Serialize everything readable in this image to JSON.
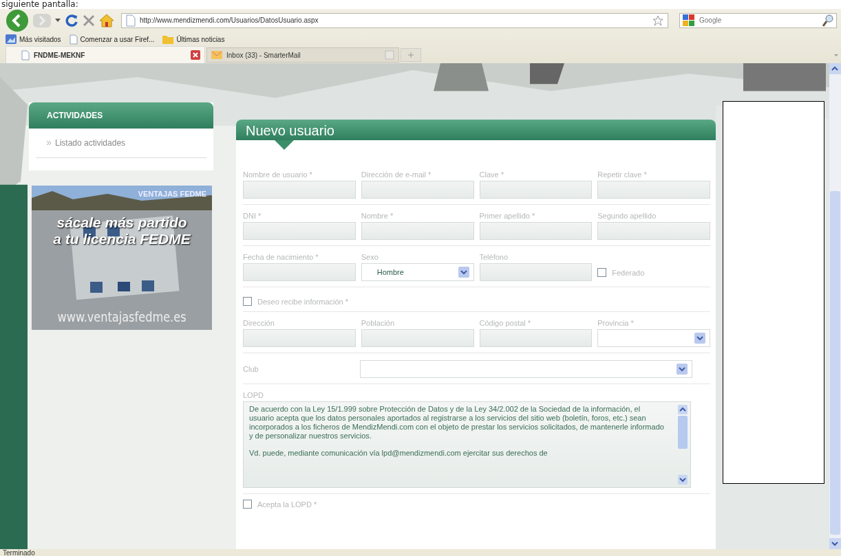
{
  "caption": "siguiente pantalla:",
  "toolbar": {
    "url": "http://www.mendizmendi.com/Usuarios/DatosUsuario.aspx",
    "search_placeholder": "Google"
  },
  "bookmarks": [
    {
      "label": "Más visitados",
      "kind": "feed"
    },
    {
      "label": "Comenzar a usar Firef...",
      "kind": "page"
    },
    {
      "label": "Últimas noticias",
      "kind": "folder"
    }
  ],
  "tabs": [
    {
      "label": "FNDME-MEKNF",
      "selected": true,
      "kind": "page"
    },
    {
      "label": "Inbox (33) - SmarterMail",
      "selected": false,
      "kind": "mail"
    }
  ],
  "sidebar": {
    "title": "ACTIVIDADES",
    "items": [
      "Listado actividades"
    ]
  },
  "banner": {
    "header": "VENTAJAS FEDME",
    "headline": [
      "sácale más partido",
      "a tu licencia FEDME"
    ],
    "url": "www.ventajasfedme.es"
  },
  "form": {
    "title": "Nuevo usuario",
    "rows": [
      [
        {
          "kind": "text",
          "label": "Nombre de usuario *"
        },
        {
          "kind": "text",
          "label": "Dirección de e-mail *"
        },
        {
          "kind": "text",
          "label": "Clave *"
        },
        {
          "kind": "text",
          "label": "Repetir clave *"
        }
      ],
      [
        {
          "kind": "text",
          "label": "DNI *"
        },
        {
          "kind": "text",
          "label": "Nombre *"
        },
        {
          "kind": "text",
          "label": "Primer apellido *"
        },
        {
          "kind": "text",
          "label": "Segundo apellido"
        }
      ],
      [
        {
          "kind": "text",
          "label": "Fecha de nacimiento *"
        },
        {
          "kind": "select",
          "label": "Sexo",
          "value": "Hombre"
        },
        {
          "kind": "text",
          "label": "Teléfono"
        },
        {
          "kind": "checkbox",
          "label": "Federado",
          "checked": false
        }
      ],
      [
        {
          "kind": "checkbox",
          "label": "Deseo recibe información *",
          "checked": false
        }
      ],
      [
        {
          "kind": "text",
          "label": "Dirección"
        },
        {
          "kind": "text",
          "label": "Población"
        },
        {
          "kind": "text",
          "label": "Código postal *"
        },
        {
          "kind": "select",
          "label": "Provincia *"
        }
      ],
      [
        {
          "kind": "wide-select",
          "label": "Club"
        }
      ]
    ],
    "lopd": {
      "label": "LOPD",
      "paragraphs": [
        "De acuerdo con la Ley 15/1.999 sobre Protección de Datos y de la Ley 34/2.002 de la Sociedad de la información, el usuario acepta que los datos personales aportados al registrarse a los servicios del sitio web (boletín, foros, etc.) sean incorporados a los ficheros de MendizMendi.com con el objeto de prestar los servicios solicitados, de mantenerle informado y de personalizar nuestros servicios.",
        "Vd. puede, mediante comunicación vía lpd@mendizmendi.com ejercitar sus derechos de"
      ]
    },
    "accept": {
      "label": "Acepta la LOPD *",
      "checked": false
    }
  },
  "status_bar": "Terminado"
}
